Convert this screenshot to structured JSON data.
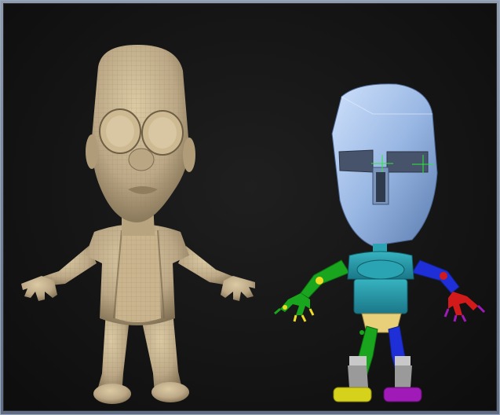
{
  "scene": {
    "background": "#141414",
    "sculpt_color": "#c9b792",
    "rig_head_color": "#a9c6ee",
    "rig_joint_colors": [
      "#19a51e",
      "#1e2fd8",
      "#2aa3b2",
      "#f0dc25",
      "#d21a1a",
      "#a01ab8"
    ],
    "models": [
      {
        "name": "sculpted-character",
        "style": "wireframe-clay"
      },
      {
        "name": "rigged-character",
        "style": "color-coded-proxy"
      }
    ]
  }
}
